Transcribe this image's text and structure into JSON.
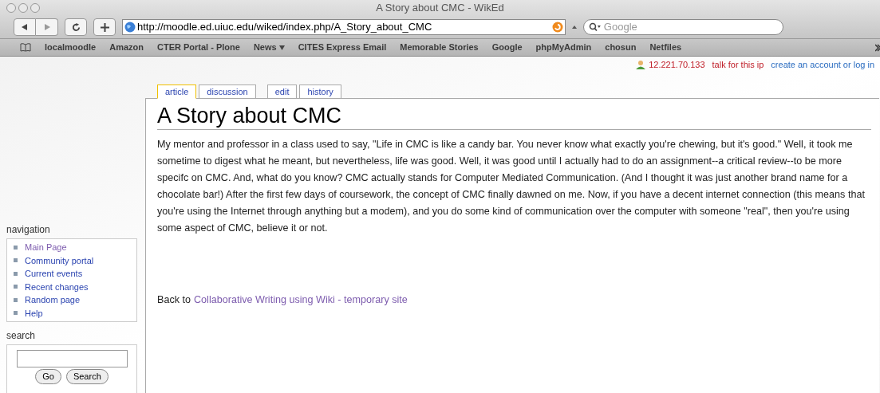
{
  "window": {
    "title": "A Story about CMC - WikEd"
  },
  "toolbar": {
    "url": "http://moodle.ed.uiuc.edu/wiked/index.php/A_Story_about_CMC",
    "search_placeholder": "Google"
  },
  "bookmarks": [
    {
      "label": "localmoodle",
      "menu": false
    },
    {
      "label": "Amazon",
      "menu": false
    },
    {
      "label": "CTER Portal - Plone",
      "menu": false
    },
    {
      "label": "News",
      "menu": true
    },
    {
      "label": "CITES Express Email",
      "menu": false
    },
    {
      "label": "Memorable Stories",
      "menu": false
    },
    {
      "label": "Google",
      "menu": false
    },
    {
      "label": "phpMyAdmin",
      "menu": false
    },
    {
      "label": "chosun",
      "menu": false
    },
    {
      "label": "Netfiles",
      "menu": false
    }
  ],
  "personal_links": {
    "ip": "12.221.70.133",
    "talk": "talk for this ip",
    "login": "create an account or log in"
  },
  "tabs": [
    {
      "label": "article",
      "selected": true
    },
    {
      "label": "discussion",
      "selected": false
    },
    {
      "label": "edit",
      "selected": false
    },
    {
      "label": "history",
      "selected": false
    }
  ],
  "article": {
    "title": "A Story about CMC",
    "body": "My mentor and professor in a class used to say, \"Life in CMC is like a candy bar. You never know what exactly you're chewing, but it's good.\" Well, it took me sometime to digest what he meant, but nevertheless, life was good. Well, it was good until I actually had to do an assignment--a critical review--to be more specifc on CMC. And, what do you know? CMC actually stands for Computer Mediated Communication. (And I thought it was just another brand name for a chocolate bar!) After the first few days of coursework, the concept of CMC finally dawned on me. Now, if you have a decent internet connection (this means that you're using the Internet through anything but a modem), and you do some kind of communication over the computer with someone \"real\", then you're using some aspect of CMC, believe it or not.",
    "back_prefix": "Back to",
    "back_link": "Collaborative Writing using Wiki - temporary site"
  },
  "navigation": {
    "heading": "navigation",
    "items": [
      {
        "label": "Main Page",
        "visited": true
      },
      {
        "label": "Community portal",
        "visited": false
      },
      {
        "label": "Current events",
        "visited": false
      },
      {
        "label": "Recent changes",
        "visited": false
      },
      {
        "label": "Random page",
        "visited": false
      },
      {
        "label": "Help",
        "visited": false
      }
    ]
  },
  "search": {
    "heading": "search",
    "buttons": [
      "Go",
      "Search"
    ]
  }
}
